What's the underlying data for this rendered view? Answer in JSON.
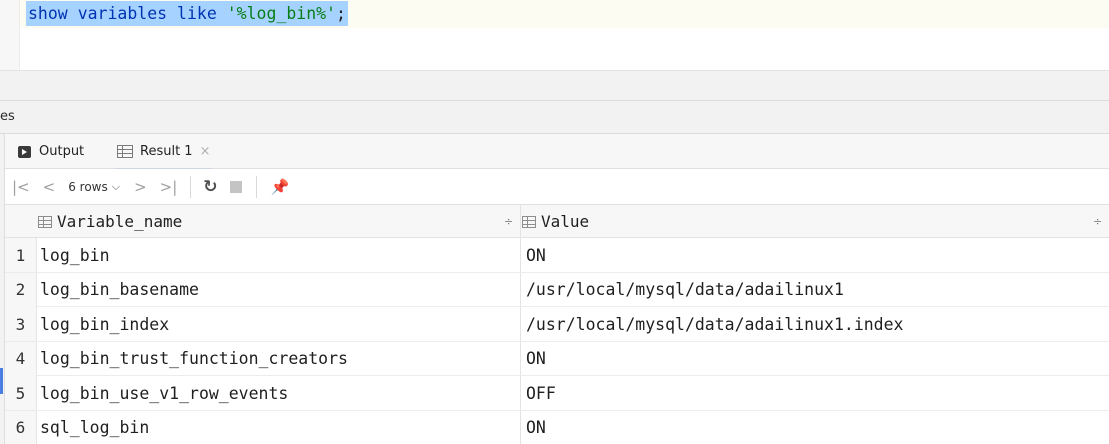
{
  "editor": {
    "keyword_show": "show",
    "keyword_variables": "variables",
    "keyword_like": "like",
    "string_literal": "'%log_bin%'",
    "terminator": ";"
  },
  "services": {
    "label": "es"
  },
  "tabs": [
    {
      "label": "Output",
      "icon": "output-console-icon"
    },
    {
      "label": "Result 1",
      "icon": "table-grid-icon",
      "close": "×"
    }
  ],
  "toolbar": {
    "first": "|<",
    "prev": "<",
    "rows_label": "6 rows",
    "rows_caret": "⌵",
    "next": ">",
    "last": ">|",
    "reload": "↻",
    "pin": "📌"
  },
  "table": {
    "columns": [
      {
        "label": "Variable_name",
        "sort": "÷"
      },
      {
        "label": "Value",
        "sort": "÷"
      }
    ],
    "rows": [
      {
        "num": "1",
        "name": "log_bin",
        "value": "ON"
      },
      {
        "num": "2",
        "name": "log_bin_basename",
        "value": "/usr/local/mysql/data/adailinux1"
      },
      {
        "num": "3",
        "name": "log_bin_index",
        "value": "/usr/local/mysql/data/adailinux1.index"
      },
      {
        "num": "4",
        "name": "log_bin_trust_function_creators",
        "value": "ON"
      },
      {
        "num": "5",
        "name": "log_bin_use_v1_row_events",
        "value": "OFF"
      },
      {
        "num": "6",
        "name": "sql_log_bin",
        "value": "ON"
      }
    ]
  },
  "colors": {
    "selection": "#a6d2ff",
    "keyword": "#0033b3",
    "string": "#067d17",
    "accent": "#4a7de1"
  }
}
